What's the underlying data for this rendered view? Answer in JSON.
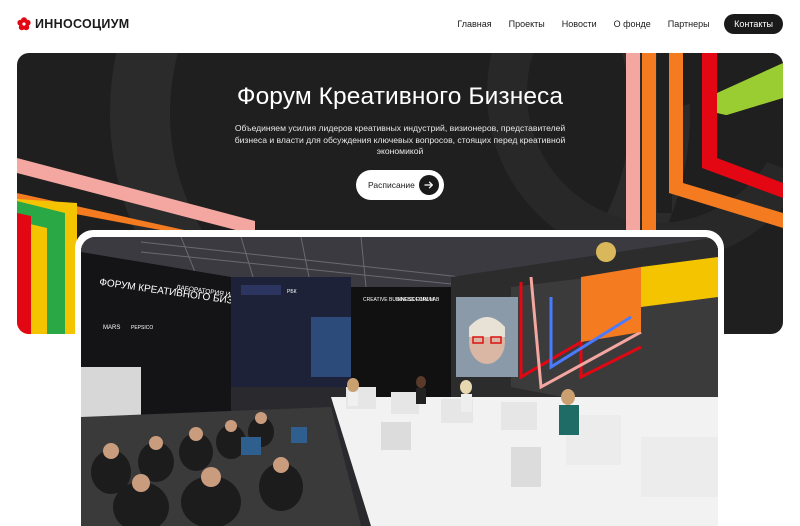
{
  "header": {
    "logo_text": "ИННОСОЦИУМ",
    "nav": [
      {
        "label": "Главная"
      },
      {
        "label": "Проекты"
      },
      {
        "label": "Новости"
      },
      {
        "label": "О фонде"
      },
      {
        "label": "Партнеры"
      }
    ],
    "contacts_label": "Контакты"
  },
  "hero": {
    "title": "Форум Креативного Бизнеса",
    "subtitle": "Объединяем усилия лидеров креативных индустрий, визионеров, представителей бизнеса и власти для обсуждения ключевых вопросов, стоящих перед креативной экономикой",
    "button_label": "Расписание"
  },
  "photo": {
    "booth_text_1": "ФОРУМ КРЕАТИВНОГО БИЗНЕСА",
    "booth_text_2": "ЛАБОРАТОРИЯ ИННОСОЦИУМ",
    "stage_text_1": "CREATIVE BUSINESS FORUM",
    "stage_text_2": "INNOSOCIUM LAB",
    "sponsor_1": "MARS",
    "sponsor_2": "PEPSICO",
    "sponsor_3": "РБК"
  },
  "colors": {
    "brand_red": "#e30613",
    "dark": "#1f1f1f",
    "pink": "#f4a6a0",
    "orange": "#f47b20",
    "lime": "#9acd32",
    "yellow": "#f5c400",
    "green": "#2aa845"
  }
}
